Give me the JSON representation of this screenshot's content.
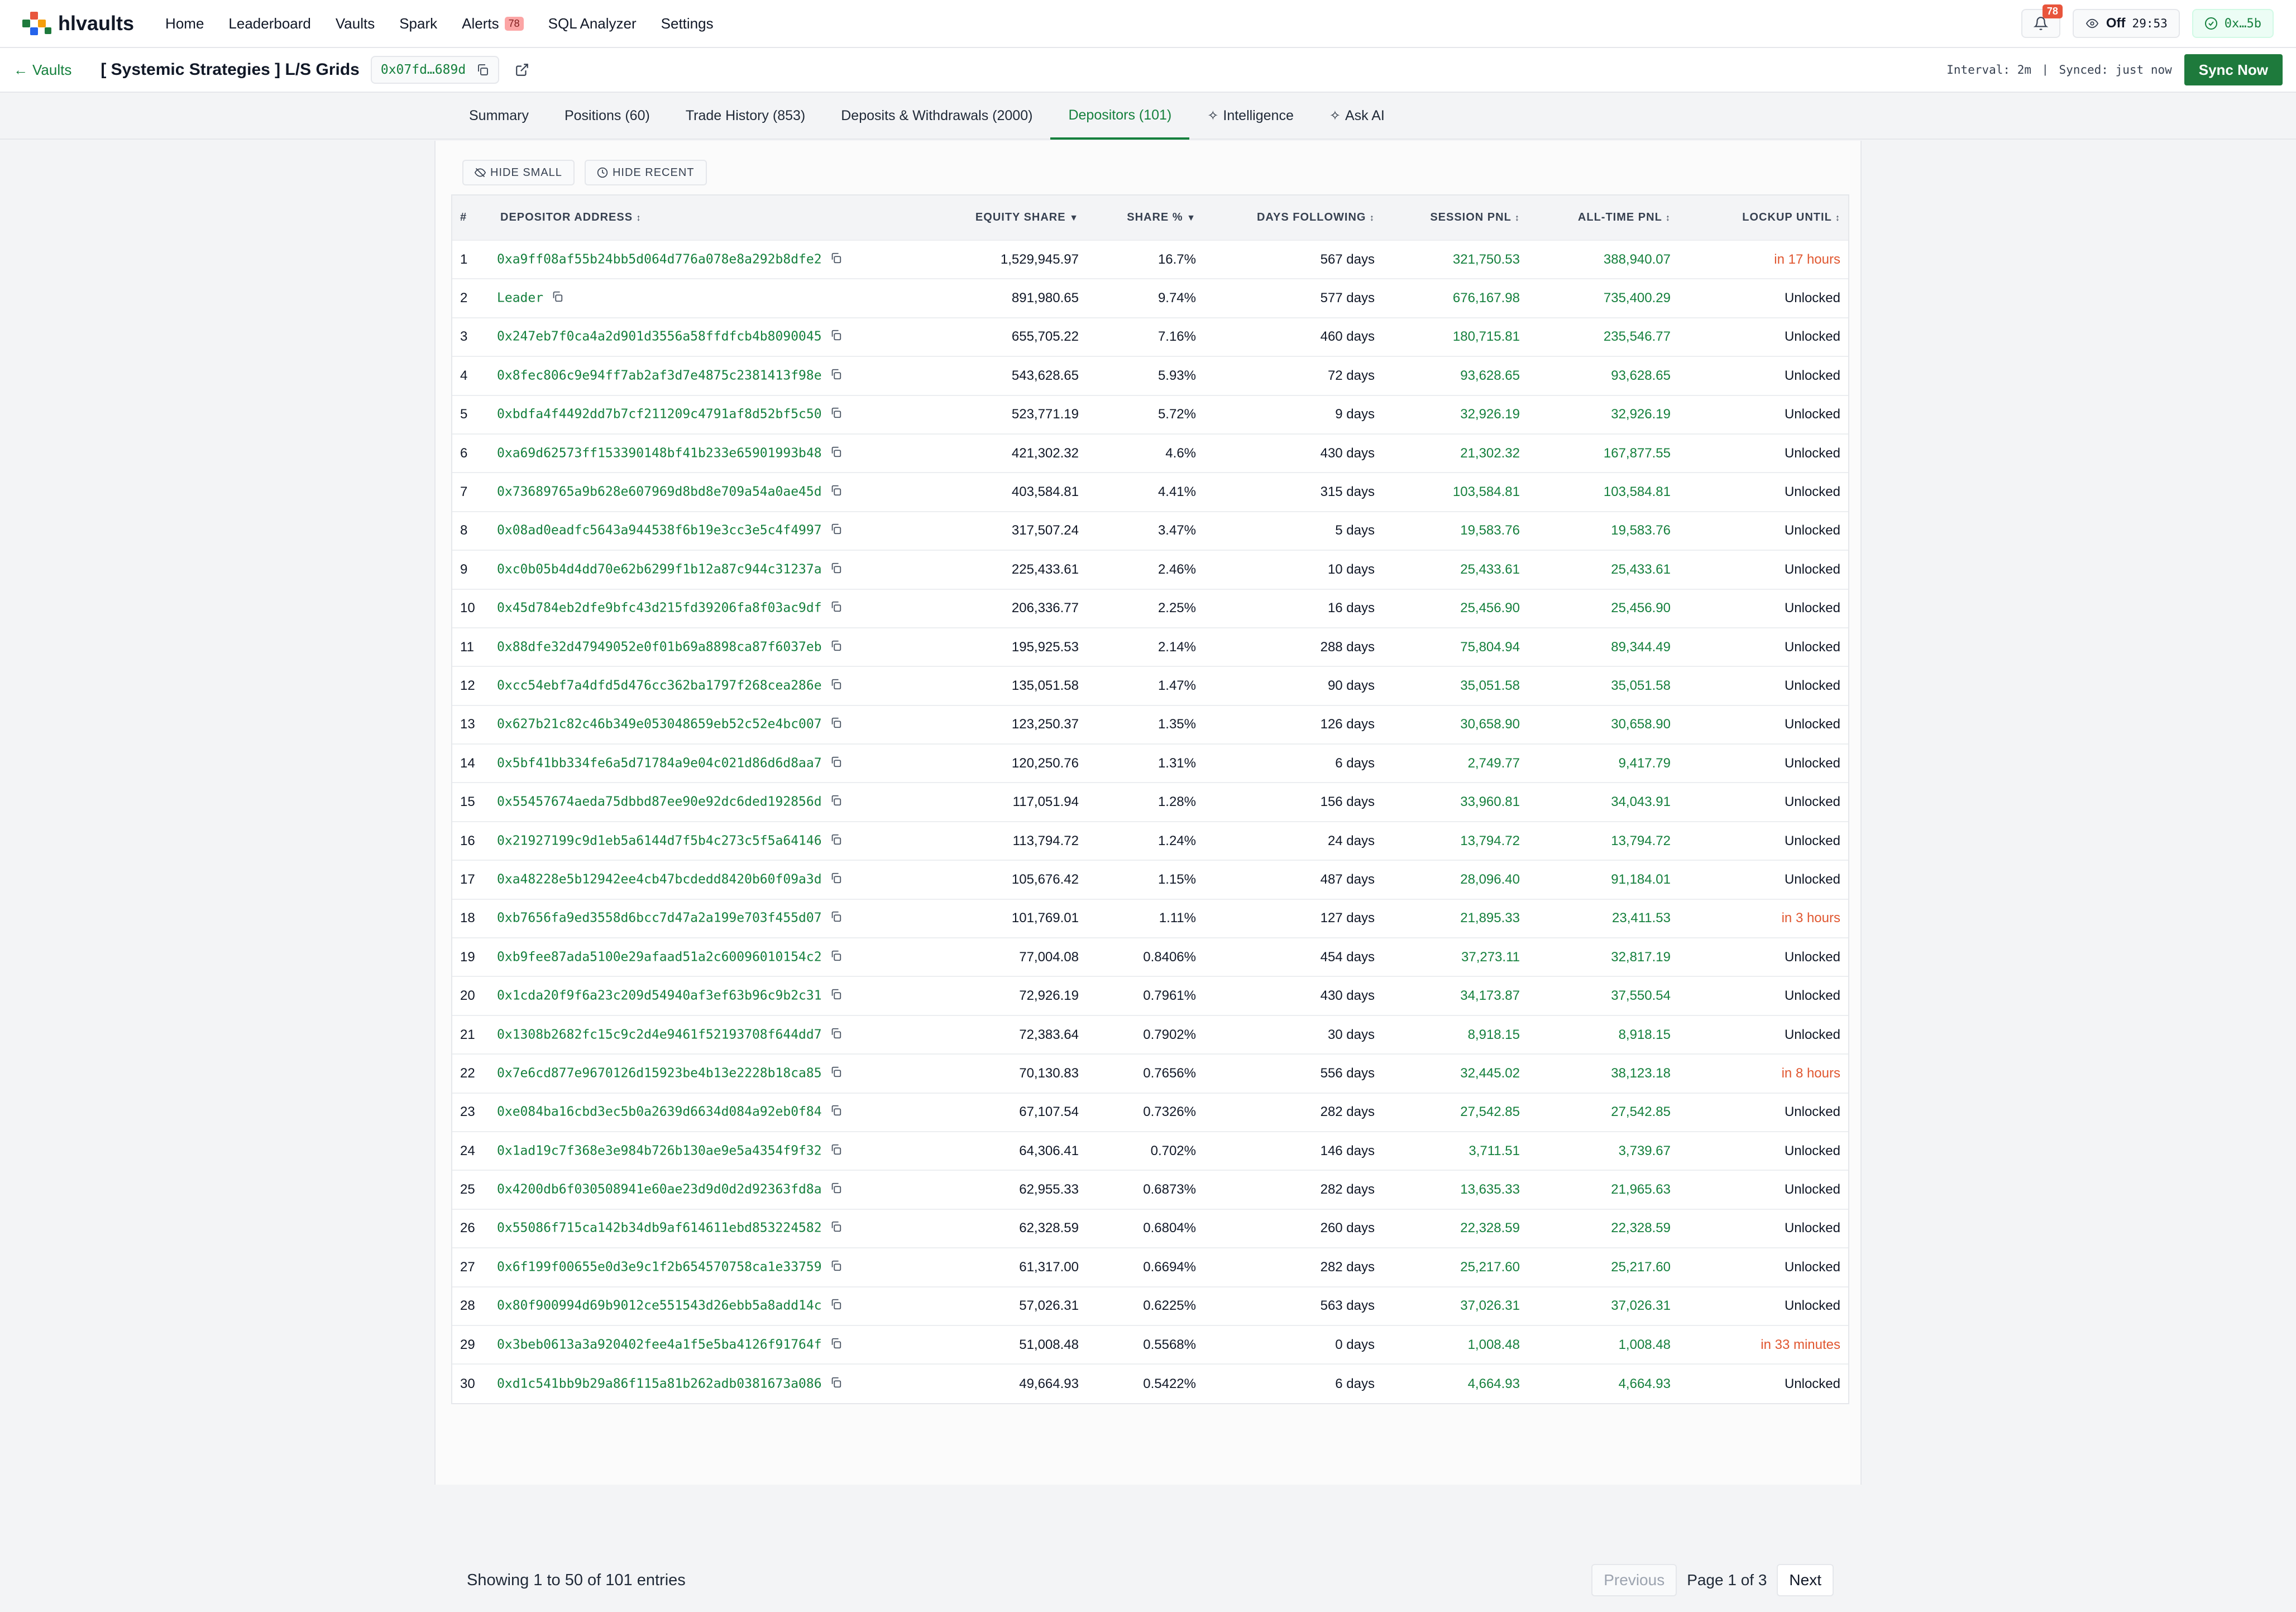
{
  "nav": {
    "brand": "hlvaults",
    "items": [
      {
        "label": "Home"
      },
      {
        "label": "Leaderboard"
      },
      {
        "label": "Vaults"
      },
      {
        "label": "Spark"
      },
      {
        "label": "Alerts",
        "badge": "78"
      },
      {
        "label": "SQL Analyzer"
      },
      {
        "label": "Settings"
      }
    ],
    "notifications_count": "78",
    "watch_status": "Off",
    "watch_timer": "29:53",
    "wallet": "0x…5b"
  },
  "vault": {
    "back_label": "Vaults",
    "title": "[ Systemic Strategies ] L/S Grids",
    "address_short": "0x07fd…689d",
    "interval": "Interval: 2m",
    "separator": "|",
    "synced": "Synced: just now",
    "sync_button": "Sync Now"
  },
  "tabs": [
    {
      "label": "Summary",
      "active": false
    },
    {
      "label": "Positions (60)",
      "active": false
    },
    {
      "label": "Trade History (853)",
      "active": false
    },
    {
      "label": "Deposits & Withdrawals (2000)",
      "active": false
    },
    {
      "label": "Depositors (101)",
      "active": true
    },
    {
      "label": "Intelligence",
      "active": false
    },
    {
      "label": "Ask AI",
      "active": false
    }
  ],
  "filters": {
    "hide_small": "HIDE SMALL",
    "hide_recent": "HIDE RECENT"
  },
  "table": {
    "headers": {
      "idx": "#",
      "address": "DEPOSITOR ADDRESS",
      "equity": "EQUITY SHARE",
      "share": "SHARE %",
      "days": "DAYS FOLLOWING",
      "session": "SESSION PNL",
      "alltime": "ALL-TIME PNL",
      "lockup": "LOCKUP UNTIL"
    },
    "sort_arrows": {
      "address": "↕",
      "equity": "▼",
      "share": "▼",
      "days": "↕",
      "session": "↕",
      "alltime": "↕",
      "lockup": "↕"
    },
    "rows": [
      {
        "idx": "1",
        "address": "0xa9ff08af55b24bb5d064d776a078e8a292b8dfe2",
        "equity": "1,529,945.97",
        "share": "16.7%",
        "days": "567 days",
        "session": "321,750.53",
        "alltime": "388,940.07",
        "lockup": "in 17 hours",
        "lock_warn": true
      },
      {
        "idx": "2",
        "address": "Leader",
        "equity": "891,980.65",
        "share": "9.74%",
        "days": "577 days",
        "session": "676,167.98",
        "alltime": "735,400.29",
        "lockup": "Unlocked",
        "lock_warn": false
      },
      {
        "idx": "3",
        "address": "0x247eb7f0ca4a2d901d3556a58ffdfcb4b8090045",
        "equity": "655,705.22",
        "share": "7.16%",
        "days": "460 days",
        "session": "180,715.81",
        "alltime": "235,546.77",
        "lockup": "Unlocked",
        "lock_warn": false
      },
      {
        "idx": "4",
        "address": "0x8fec806c9e94ff7ab2af3d7e4875c2381413f98e",
        "equity": "543,628.65",
        "share": "5.93%",
        "days": "72 days",
        "session": "93,628.65",
        "alltime": "93,628.65",
        "lockup": "Unlocked",
        "lock_warn": false
      },
      {
        "idx": "5",
        "address": "0xbdfa4f4492dd7b7cf211209c4791af8d52bf5c50",
        "equity": "523,771.19",
        "share": "5.72%",
        "days": "9 days",
        "session": "32,926.19",
        "alltime": "32,926.19",
        "lockup": "Unlocked",
        "lock_warn": false
      },
      {
        "idx": "6",
        "address": "0xa69d62573ff153390148bf41b233e65901993b48",
        "equity": "421,302.32",
        "share": "4.6%",
        "days": "430 days",
        "session": "21,302.32",
        "alltime": "167,877.55",
        "lockup": "Unlocked",
        "lock_warn": false
      },
      {
        "idx": "7",
        "address": "0x73689765a9b628e607969d8bd8e709a54a0ae45d",
        "equity": "403,584.81",
        "share": "4.41%",
        "days": "315 days",
        "session": "103,584.81",
        "alltime": "103,584.81",
        "lockup": "Unlocked",
        "lock_warn": false
      },
      {
        "idx": "8",
        "address": "0x08ad0eadfc5643a944538f6b19e3cc3e5c4f4997",
        "equity": "317,507.24",
        "share": "3.47%",
        "days": "5 days",
        "session": "19,583.76",
        "alltime": "19,583.76",
        "lockup": "Unlocked",
        "lock_warn": false
      },
      {
        "idx": "9",
        "address": "0xc0b05b4d4dd70e62b6299f1b12a87c944c31237a",
        "equity": "225,433.61",
        "share": "2.46%",
        "days": "10 days",
        "session": "25,433.61",
        "alltime": "25,433.61",
        "lockup": "Unlocked",
        "lock_warn": false
      },
      {
        "idx": "10",
        "address": "0x45d784eb2dfe9bfc43d215fd39206fa8f03ac9df",
        "equity": "206,336.77",
        "share": "2.25%",
        "days": "16 days",
        "session": "25,456.90",
        "alltime": "25,456.90",
        "lockup": "Unlocked",
        "lock_warn": false
      },
      {
        "idx": "11",
        "address": "0x88dfe32d47949052e0f01b69a8898ca87f6037eb",
        "equity": "195,925.53",
        "share": "2.14%",
        "days": "288 days",
        "session": "75,804.94",
        "alltime": "89,344.49",
        "lockup": "Unlocked",
        "lock_warn": false
      },
      {
        "idx": "12",
        "address": "0xcc54ebf7a4dfd5d476cc362ba1797f268cea286e",
        "equity": "135,051.58",
        "share": "1.47%",
        "days": "90 days",
        "session": "35,051.58",
        "alltime": "35,051.58",
        "lockup": "Unlocked",
        "lock_warn": false
      },
      {
        "idx": "13",
        "address": "0x627b21c82c46b349e053048659eb52c52e4bc007",
        "equity": "123,250.37",
        "share": "1.35%",
        "days": "126 days",
        "session": "30,658.90",
        "alltime": "30,658.90",
        "lockup": "Unlocked",
        "lock_warn": false
      },
      {
        "idx": "14",
        "address": "0x5bf41bb334fe6a5d71784a9e04c021d86d6d8aa7",
        "equity": "120,250.76",
        "share": "1.31%",
        "days": "6 days",
        "session": "2,749.77",
        "alltime": "9,417.79",
        "lockup": "Unlocked",
        "lock_warn": false
      },
      {
        "idx": "15",
        "address": "0x55457674aeda75dbbd87ee90e92dc6ded192856d",
        "equity": "117,051.94",
        "share": "1.28%",
        "days": "156 days",
        "session": "33,960.81",
        "alltime": "34,043.91",
        "lockup": "Unlocked",
        "lock_warn": false
      },
      {
        "idx": "16",
        "address": "0x21927199c9d1eb5a6144d7f5b4c273c5f5a64146",
        "equity": "113,794.72",
        "share": "1.24%",
        "days": "24 days",
        "session": "13,794.72",
        "alltime": "13,794.72",
        "lockup": "Unlocked",
        "lock_warn": false
      },
      {
        "idx": "17",
        "address": "0xa48228e5b12942ee4cb47bcdedd8420b60f09a3d",
        "equity": "105,676.42",
        "share": "1.15%",
        "days": "487 days",
        "session": "28,096.40",
        "alltime": "91,184.01",
        "lockup": "Unlocked",
        "lock_warn": false
      },
      {
        "idx": "18",
        "address": "0xb7656fa9ed3558d6bcc7d47a2a199e703f455d07",
        "equity": "101,769.01",
        "share": "1.11%",
        "days": "127 days",
        "session": "21,895.33",
        "alltime": "23,411.53",
        "lockup": "in 3 hours",
        "lock_warn": true
      },
      {
        "idx": "19",
        "address": "0xb9fee87ada5100e29afaad51a2c60096010154c2",
        "equity": "77,004.08",
        "share": "0.8406%",
        "days": "454 days",
        "session": "37,273.11",
        "alltime": "32,817.19",
        "lockup": "Unlocked",
        "lock_warn": false
      },
      {
        "idx": "20",
        "address": "0x1cda20f9f6a23c209d54940af3ef63b96c9b2c31",
        "equity": "72,926.19",
        "share": "0.7961%",
        "days": "430 days",
        "session": "34,173.87",
        "alltime": "37,550.54",
        "lockup": "Unlocked",
        "lock_warn": false
      },
      {
        "idx": "21",
        "address": "0x1308b2682fc15c9c2d4e9461f52193708f644dd7",
        "equity": "72,383.64",
        "share": "0.7902%",
        "days": "30 days",
        "session": "8,918.15",
        "alltime": "8,918.15",
        "lockup": "Unlocked",
        "lock_warn": false
      },
      {
        "idx": "22",
        "address": "0x7e6cd877e9670126d15923be4b13e2228b18ca85",
        "equity": "70,130.83",
        "share": "0.7656%",
        "days": "556 days",
        "session": "32,445.02",
        "alltime": "38,123.18",
        "lockup": "in 8 hours",
        "lock_warn": true
      },
      {
        "idx": "23",
        "address": "0xe084ba16cbd3ec5b0a2639d6634d084a92eb0f84",
        "equity": "67,107.54",
        "share": "0.7326%",
        "days": "282 days",
        "session": "27,542.85",
        "alltime": "27,542.85",
        "lockup": "Unlocked",
        "lock_warn": false
      },
      {
        "idx": "24",
        "address": "0x1ad19c7f368e3e984b726b130ae9e5a4354f9f32",
        "equity": "64,306.41",
        "share": "0.702%",
        "days": "146 days",
        "session": "3,711.51",
        "alltime": "3,739.67",
        "lockup": "Unlocked",
        "lock_warn": false
      },
      {
        "idx": "25",
        "address": "0x4200db6f030508941e60ae23d9d0d2d92363fd8a",
        "equity": "62,955.33",
        "share": "0.6873%",
        "days": "282 days",
        "session": "13,635.33",
        "alltime": "21,965.63",
        "lockup": "Unlocked",
        "lock_warn": false
      },
      {
        "idx": "26",
        "address": "0x55086f715ca142b34db9af614611ebd853224582",
        "equity": "62,328.59",
        "share": "0.6804%",
        "days": "260 days",
        "session": "22,328.59",
        "alltime": "22,328.59",
        "lockup": "Unlocked",
        "lock_warn": false
      },
      {
        "idx": "27",
        "address": "0x6f199f00655e0d3e9c1f2b654570758ca1e33759",
        "equity": "61,317.00",
        "share": "0.6694%",
        "days": "282 days",
        "session": "25,217.60",
        "alltime": "25,217.60",
        "lockup": "Unlocked",
        "lock_warn": false
      },
      {
        "idx": "28",
        "address": "0x80f900994d69b9012ce551543d26ebb5a8add14c",
        "equity": "57,026.31",
        "share": "0.6225%",
        "days": "563 days",
        "session": "37,026.31",
        "alltime": "37,026.31",
        "lockup": "Unlocked",
        "lock_warn": false
      },
      {
        "idx": "29",
        "address": "0x3beb0613a3a920402fee4a1f5e5ba4126f91764f",
        "equity": "51,008.48",
        "share": "0.5568%",
        "days": "0 days",
        "session": "1,008.48",
        "alltime": "1,008.48",
        "lockup": "in 33 minutes",
        "lock_warn": true
      },
      {
        "idx": "30",
        "address": "0xd1c541bb9b29a86f115a81b262adb0381673a086",
        "equity": "49,664.93",
        "share": "0.5422%",
        "days": "6 days",
        "session": "4,664.93",
        "alltime": "4,664.93",
        "lockup": "Unlocked",
        "lock_warn": false
      }
    ]
  },
  "footer": {
    "showing": "Showing 1 to 50 of 101 entries",
    "previous": "Previous",
    "page": "Page 1 of 3",
    "next": "Next"
  },
  "colors": {
    "accent": "#15803d",
    "warn": "#e0562f",
    "sync_button": "#1e7a3c"
  }
}
